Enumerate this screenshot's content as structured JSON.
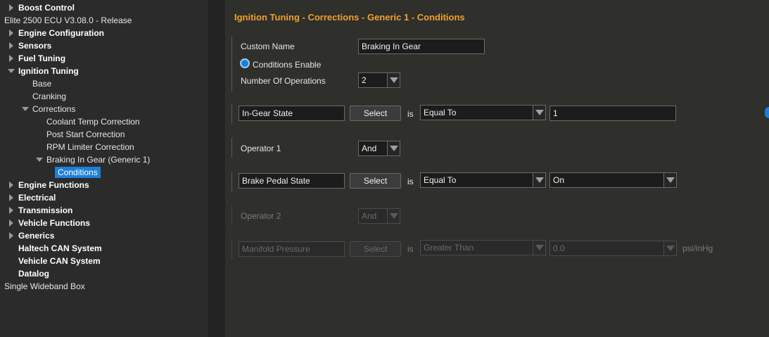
{
  "tree": {
    "items": [
      {
        "label": "Boost Control",
        "bold": true,
        "arrow": "right",
        "level": 1
      },
      {
        "label": "Elite 2500 ECU V3.08.0 - Release",
        "bold": false,
        "arrow": "none",
        "level": 0
      },
      {
        "label": "Engine Configuration",
        "bold": true,
        "arrow": "right",
        "level": 1
      },
      {
        "label": "Sensors",
        "bold": true,
        "arrow": "right",
        "level": 1
      },
      {
        "label": "Fuel Tuning",
        "bold": true,
        "arrow": "right",
        "level": 1
      },
      {
        "label": "Ignition Tuning",
        "bold": true,
        "arrow": "down",
        "level": 1
      },
      {
        "label": "Base",
        "bold": false,
        "arrow": "none",
        "level": 2
      },
      {
        "label": "Cranking",
        "bold": false,
        "arrow": "none",
        "level": 2
      },
      {
        "label": "Corrections",
        "bold": false,
        "arrow": "down",
        "level": 2
      },
      {
        "label": "Coolant Temp Correction",
        "bold": false,
        "arrow": "none",
        "level": 3
      },
      {
        "label": "Post Start Correction",
        "bold": false,
        "arrow": "none",
        "level": 3
      },
      {
        "label": "RPM Limiter Correction",
        "bold": false,
        "arrow": "none",
        "level": 3
      },
      {
        "label": "Braking In Gear (Generic 1)",
        "bold": false,
        "arrow": "down",
        "level": 3
      },
      {
        "label": "Conditions",
        "bold": false,
        "arrow": "none",
        "level": 4,
        "selected": true
      },
      {
        "label": "Engine Functions",
        "bold": true,
        "arrow": "right",
        "level": 1
      },
      {
        "label": "Electrical",
        "bold": true,
        "arrow": "right",
        "level": 1
      },
      {
        "label": "Transmission",
        "bold": true,
        "arrow": "right",
        "level": 1
      },
      {
        "label": "Vehicle Functions",
        "bold": true,
        "arrow": "right",
        "level": 1
      },
      {
        "label": "Generics",
        "bold": true,
        "arrow": "right",
        "level": 1
      },
      {
        "label": "Haltech CAN System",
        "bold": true,
        "arrow": "none",
        "level": 1
      },
      {
        "label": "Vehicle CAN System",
        "bold": true,
        "arrow": "none",
        "level": 1
      },
      {
        "label": "Datalog",
        "bold": true,
        "arrow": "none",
        "level": 1
      },
      {
        "label": "Single Wideband Box",
        "bold": false,
        "arrow": "none",
        "level": 0
      }
    ]
  },
  "page": {
    "title": "Ignition Tuning - Corrections - Generic 1 - Conditions"
  },
  "settings": {
    "custom_name_label": "Custom Name",
    "custom_name_value": "Braking In Gear",
    "conditions_enable_label": "Conditions Enable",
    "num_operations_label": "Number Of Operations",
    "num_operations_value": "2"
  },
  "conditions": {
    "c1": {
      "channel": "In-Gear State",
      "select": "Select",
      "is": "is",
      "comparison": "Equal To",
      "value": "1"
    },
    "op1": {
      "label": "Operator 1",
      "value": "And"
    },
    "c2": {
      "channel": "Brake Pedal State",
      "select": "Select",
      "is": "is",
      "comparison": "Equal To",
      "value": "On"
    },
    "op2": {
      "label": "Operator 2",
      "value": "And"
    },
    "c3": {
      "channel": "Manifold Pressure",
      "select": "Select",
      "is": "is",
      "comparison": "Greater Than",
      "value": "0.0",
      "unit": "psi/inHg"
    }
  },
  "colors": {
    "accent": "#1e7fd8",
    "title": "#f0a030"
  }
}
